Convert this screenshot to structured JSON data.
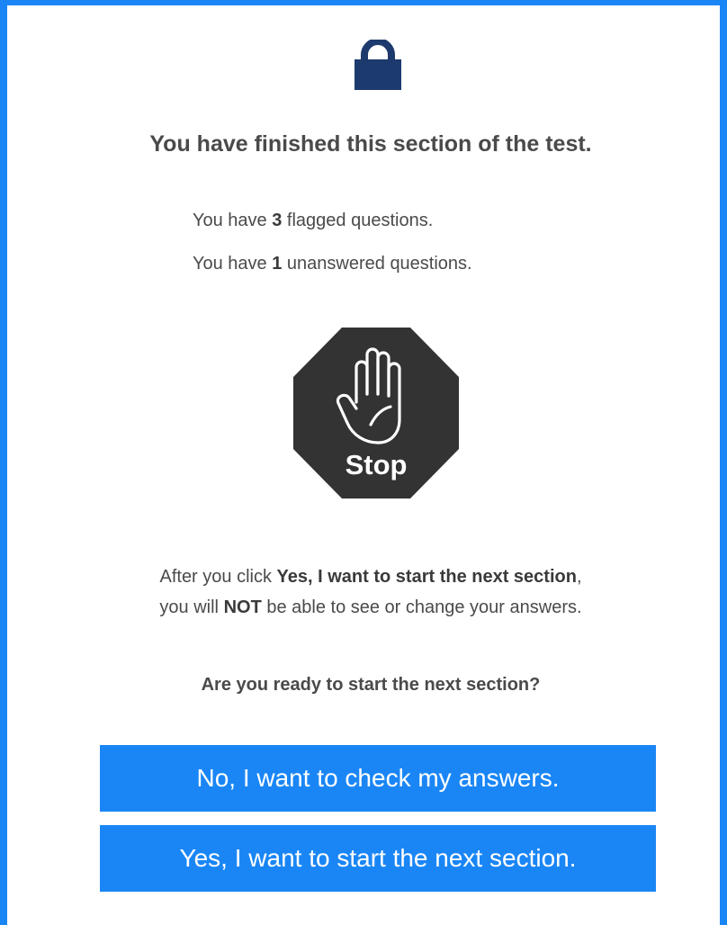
{
  "dialog": {
    "title": "You have finished this section of the test.",
    "flagged": {
      "prefix": "You have ",
      "count": "3",
      "suffix": " flagged questions."
    },
    "unanswered": {
      "prefix": "You have ",
      "count": "1",
      "suffix": " unanswered questions."
    },
    "stop_label": "Stop",
    "warning": {
      "part1": "After you click ",
      "bold1": "Yes, I want to start the next section",
      "part2": ",",
      "part3": "you will ",
      "bold2": "NOT",
      "part4": " be able to see or change your answers."
    },
    "question": "Are you ready to start the next section?",
    "buttons": {
      "no_label": "No, I want to check my answers.",
      "yes_label": "Yes, I want to start the next section."
    }
  },
  "colors": {
    "accent": "#1a86f5",
    "lock": "#1d3a6e",
    "stop_sign": "#333333",
    "text": "#4a4a4a"
  },
  "icons": {
    "lock": "lock-icon",
    "stop": "stop-hand-icon"
  }
}
